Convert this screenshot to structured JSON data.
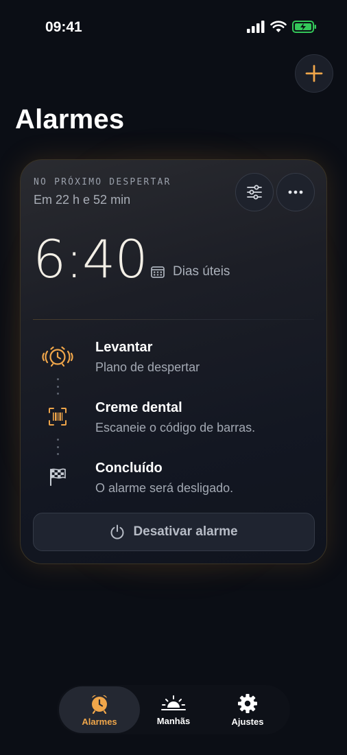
{
  "status_bar": {
    "time": "09:41"
  },
  "header": {
    "title": "Alarmes",
    "add_icon": "plus-icon"
  },
  "card": {
    "next_label": "NO PRÓXIMO DESPERTAR",
    "eta": "Em 22 h e 52 min",
    "time": "6:40",
    "days": "Dias úteis",
    "steps": [
      {
        "title": "Levantar",
        "subtitle": "Plano de despertar",
        "icon": "ringing-alarm-icon"
      },
      {
        "title": "Creme dental",
        "subtitle": "Escaneie o código de barras.",
        "icon": "barcode-scan-icon"
      },
      {
        "title": "Concluído",
        "subtitle": "O alarme será desligado.",
        "icon": "checkered-flag-icon"
      }
    ],
    "deactivate_label": "Desativar alarme"
  },
  "tabs": [
    {
      "label": "Alarmes",
      "icon": "alarm-clock-icon",
      "active": true
    },
    {
      "label": "Manhãs",
      "icon": "sunrise-icon",
      "active": false
    },
    {
      "label": "Ajustes",
      "icon": "gear-icon",
      "active": false
    }
  ],
  "colors": {
    "accent": "#f0a64a",
    "background": "#0b0e15",
    "card": "#131722",
    "battery": "#34c759"
  }
}
